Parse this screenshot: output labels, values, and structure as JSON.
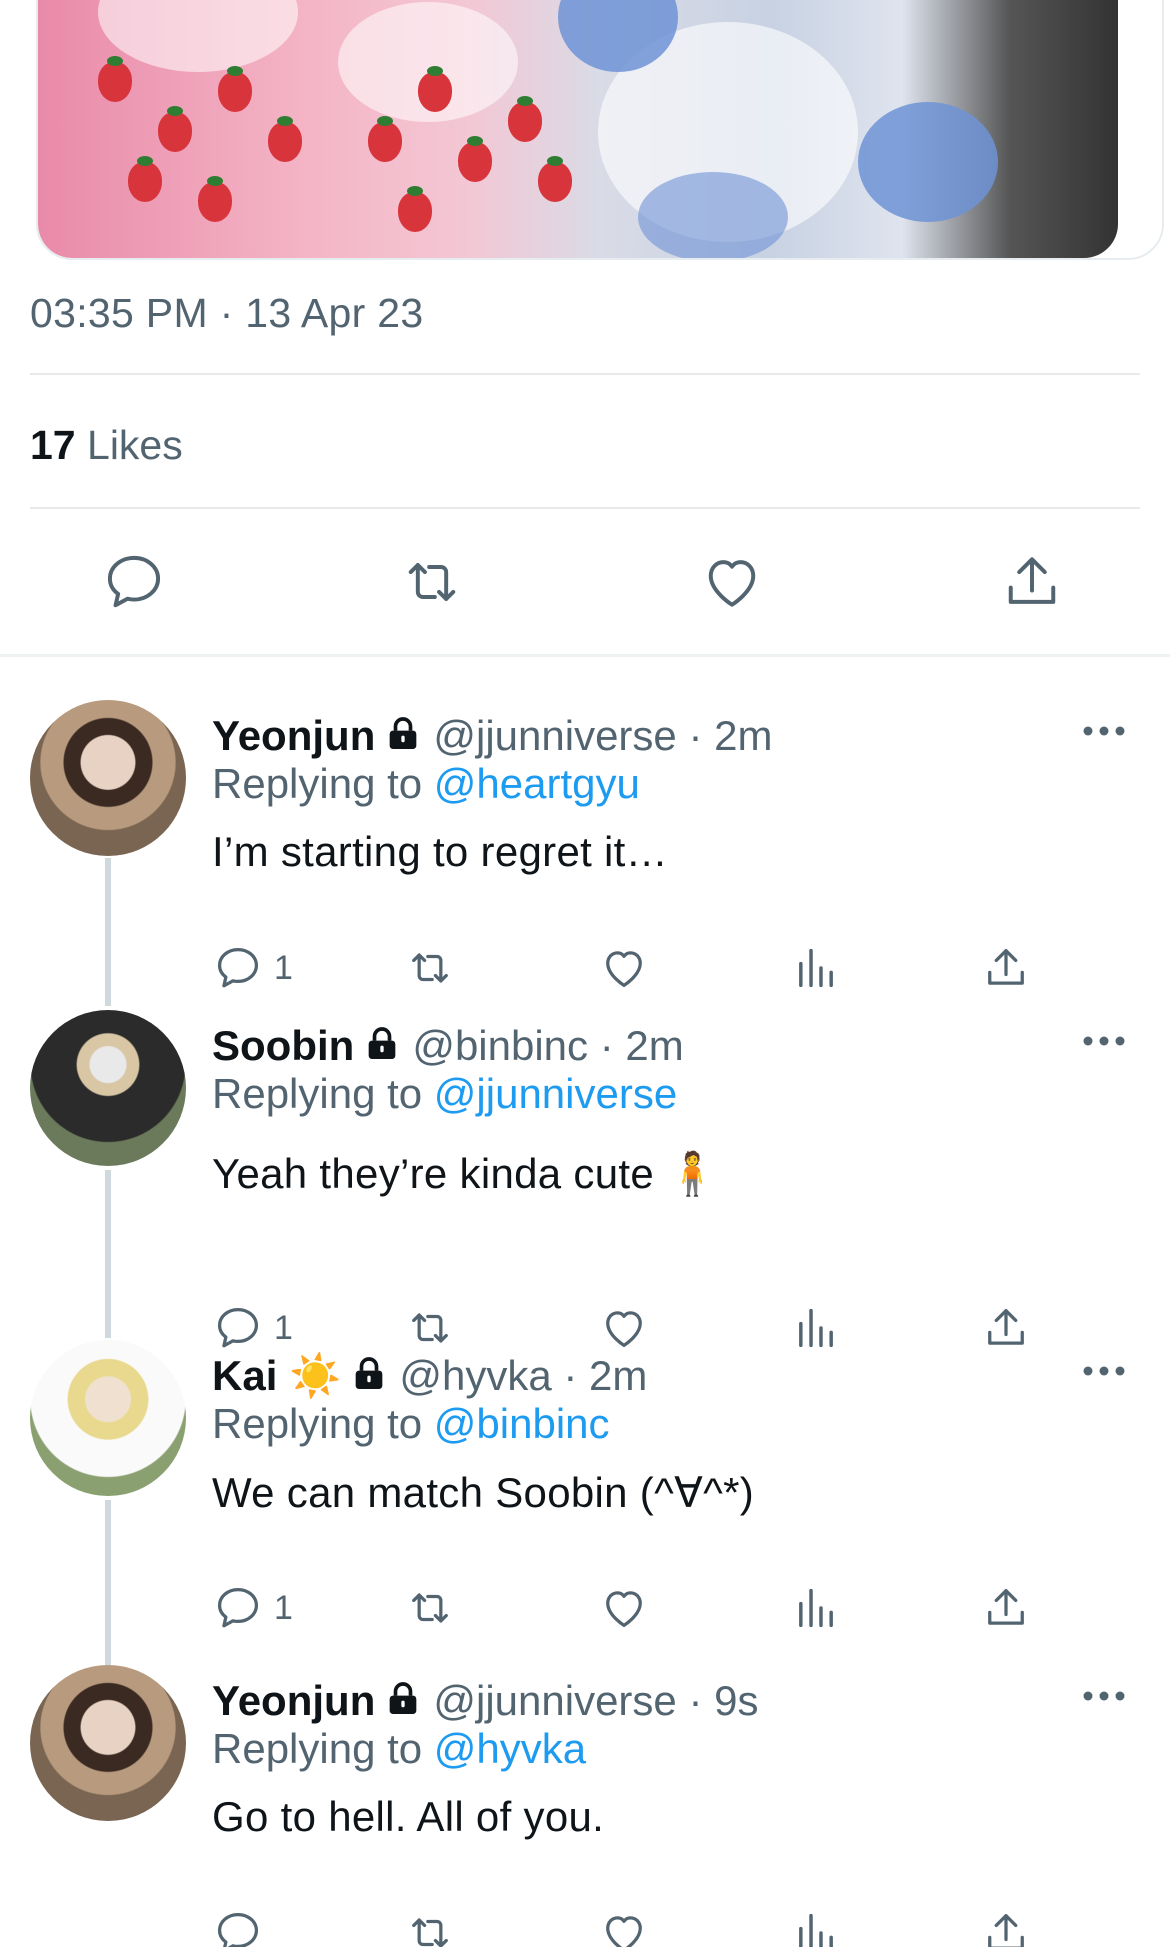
{
  "tweet": {
    "timestamp": "03:35 PM · 13 Apr 23",
    "likes_count": "17",
    "likes_label": "Likes"
  },
  "icons": {
    "reply": "reply-icon",
    "retweet": "retweet-icon",
    "like": "like-icon",
    "share": "share-icon",
    "views": "views-icon",
    "lock": "lock-icon",
    "more": "more-icon"
  },
  "colors": {
    "link": "#1d9bf0",
    "secondary_text": "#536471",
    "primary_text": "#0f1419"
  },
  "replies": [
    {
      "name": "Yeonjun",
      "handle": "@jjunniverse",
      "time": "· 2m",
      "replying_label": "Replying to",
      "replying_to": "@heartgyu",
      "text": "I’m starting to regret it…",
      "reply_count": "1"
    },
    {
      "name": "Soobin",
      "handle": "@binbinc",
      "time": "· 2m",
      "replying_label": "Replying to",
      "replying_to": "@jjunniverse",
      "text": "Yeah they’re kinda cute 🧍",
      "reply_count": "1"
    },
    {
      "name": "Kai ☀️",
      "handle": "@hyvka",
      "time": "· 2m",
      "replying_label": "Replying to",
      "replying_to": "@binbinc",
      "text": "We can match Soobin (^∀^*)",
      "reply_count": "1"
    },
    {
      "name": "Yeonjun",
      "handle": "@jjunniverse",
      "time": "· 9s",
      "replying_label": "Replying to",
      "replying_to": "@hyvka",
      "text": "Go to hell. All of you.",
      "reply_count": ""
    }
  ]
}
